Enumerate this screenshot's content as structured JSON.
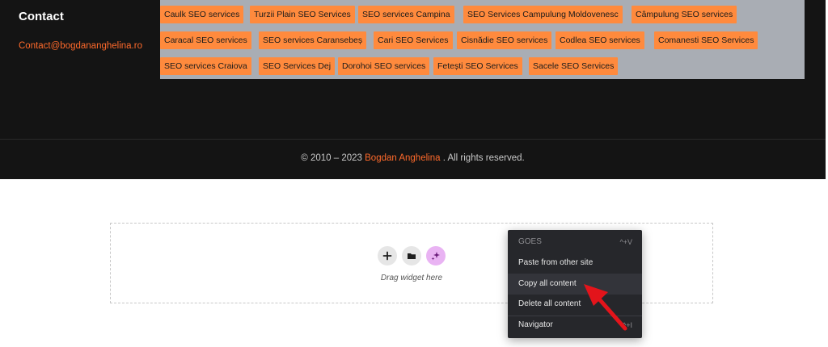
{
  "footer": {
    "contact_heading": "Contact",
    "contact_email": "Contact@bogdananghelina.ro",
    "tags": [
      "Caulk SEO services",
      "Turzii Plain SEO Services",
      "SEO services Campina",
      "SEO Services Campulung Moldovenesc",
      "Câmpulung SEO services",
      "Caracal SEO services",
      "SEO services Caransebeș",
      "Cari SEO Services",
      "Cisnădie SEO services",
      "Codlea SEO services",
      "Comanesti SEO Services",
      "SEO services Craiova",
      "SEO Services Dej",
      "Dorohoi SEO services",
      "Fetești SEO Services",
      "Sacele SEO Services"
    ],
    "copyright_prefix": "© 2010 – 2023 ",
    "copyright_brand": "Bogdan Anghelina",
    "copyright_suffix": " . All rights reserved."
  },
  "editor": {
    "dropzone_hint": "Drag widget here",
    "buttons": {
      "add": "add-icon",
      "template": "folder-icon",
      "ai": "sparkle-icon"
    }
  },
  "context_menu": {
    "header": "GOES",
    "header_shortcut": "^+V",
    "items": [
      {
        "label": "Paste from other site",
        "shortcut": ""
      },
      {
        "label": "Copy all content",
        "shortcut": ""
      },
      {
        "label": "Delete all content",
        "shortcut": ""
      },
      {
        "label": "Navigator",
        "shortcut": "^+I"
      }
    ]
  },
  "colors": {
    "footer_bg": "#141414",
    "accent": "#ff6a2b",
    "tag_bg": "#ff8a3d",
    "tag_panel_bg": "#a9adb4",
    "menu_bg": "#26272b",
    "arrow": "#e3141b",
    "ai_button_bg": "#e9b3f3"
  }
}
